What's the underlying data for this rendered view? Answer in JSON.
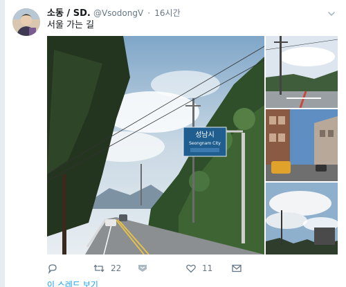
{
  "tweet": {
    "author_name": "소동 / SD.",
    "handle": "@VsodongV",
    "separator": "·",
    "time": "16시간",
    "text": "서울 가는 길",
    "photo_count": 4
  },
  "actions": {
    "reply_count": "",
    "retweet_count": "22",
    "like_count": "11"
  },
  "thread_link": "이 스레드 보기",
  "icons": {
    "reply": "reply-icon",
    "retweet": "retweet-icon",
    "direct": "direct-message-icon",
    "like": "heart-icon",
    "mail": "envelope-icon",
    "more": "chevron-down-icon"
  },
  "colors": {
    "link": "#1da1f2",
    "muted": "#657786",
    "text": "#14171a",
    "sign_blue": "#1f5e8f"
  },
  "photos": {
    "main_sign_text": "성남시",
    "main_sign_sub": "Seongnam City"
  }
}
